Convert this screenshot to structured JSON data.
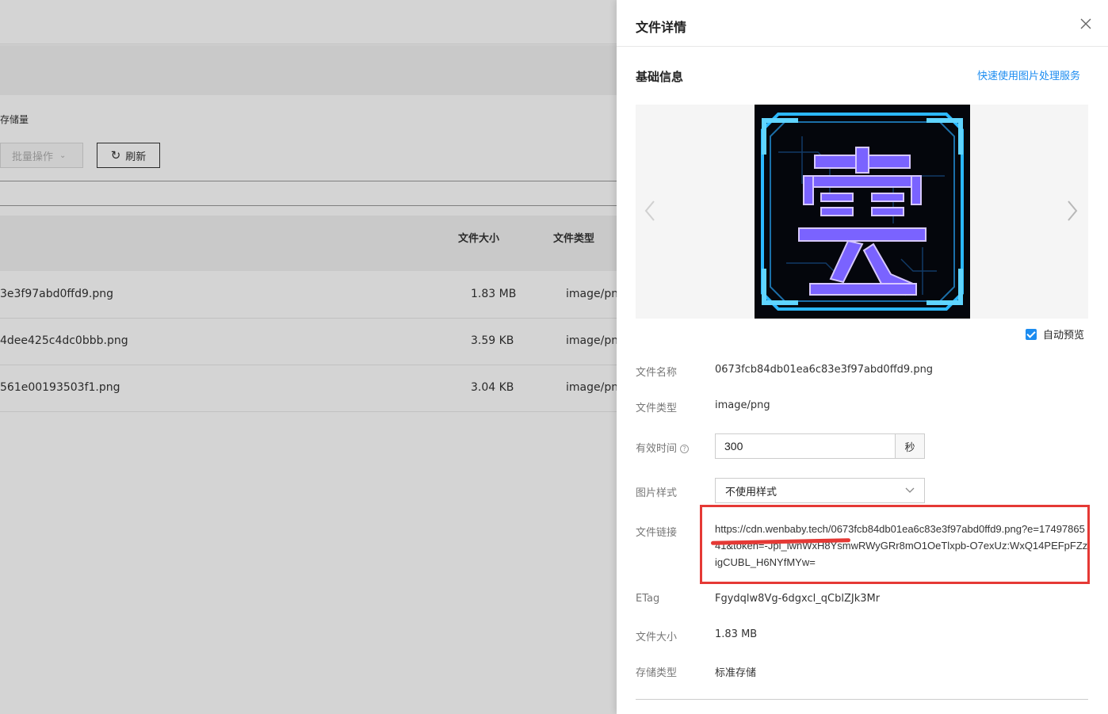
{
  "background": {
    "storage_label": "存储量",
    "batch_button": "批量操作",
    "refresh_button": "刷新",
    "columns": {
      "size": "文件大小",
      "type": "文件类型"
    },
    "rows": [
      {
        "name": "3e3f97abd0ffd9.png",
        "size": "1.83 MB",
        "type": "image/png"
      },
      {
        "name": "4dee425c4dc0bbb.png",
        "size": "3.59 KB",
        "type": "image/png"
      },
      {
        "name": "561e00193503f1.png",
        "size": "3.04 KB",
        "type": "image/png"
      }
    ]
  },
  "drawer": {
    "title": "文件详情",
    "section_title": "基础信息",
    "quick_link": "快速使用图片处理服务",
    "auto_preview_label": "自动预览",
    "auto_preview_checked": true,
    "fields": {
      "name_label": "文件名称",
      "name_value": "0673fcb84db01ea6c83e3f97abd0ffd9.png",
      "type_label": "文件类型",
      "type_value": "image/png",
      "expiry_label": "有效时间",
      "expiry_value": "300",
      "expiry_unit": "秒",
      "style_label": "图片样式",
      "style_value": "不使用样式",
      "link_label": "文件链接",
      "link_value": "https://cdn.wenbaby.tech/0673fcb84db01ea6c83e3f97abd0ffd9.png?e=1749786541&token=-Jpl_lwnWxH8YsmwRWyGRr8mO1OeTlxpb-O7exUz:WxQ14PEFpFZzigCUBL_H6NYfMYw=",
      "etag_label": "ETag",
      "etag_value": "Fgydqlw8Vg-6dgxcl_qCblZJk3Mr",
      "size_label": "文件大小",
      "size_value": "1.83 MB",
      "storage_label": "存储类型",
      "storage_value": "标准存储"
    }
  },
  "colors": {
    "accent": "#1c8cf0",
    "highlight": "#e53935",
    "thumb_glow": "#2bb8ff",
    "thumb_glyph": "#6a5cff"
  }
}
